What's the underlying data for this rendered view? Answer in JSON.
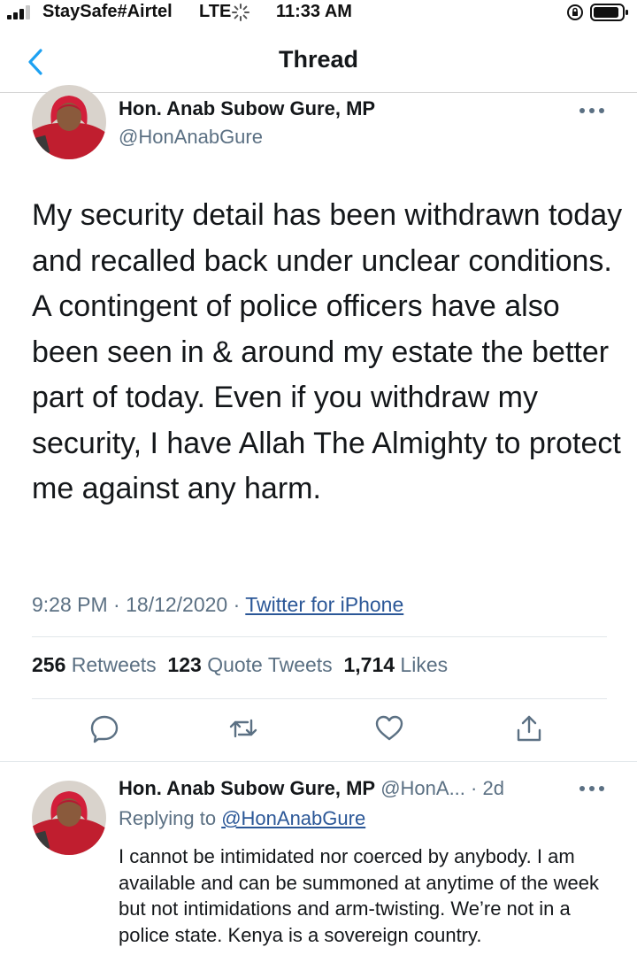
{
  "status_bar": {
    "carrier": "StaySafe#Airtel",
    "network": "LTE",
    "time": "11:33 AM"
  },
  "nav": {
    "title": "Thread",
    "back_icon": "chevron-left-icon"
  },
  "tweet": {
    "author_name": "Hon. Anab Subow Gure, MP",
    "author_handle": "@HonAnabGure",
    "text": "My security detail has been withdrawn today and recalled back under unclear conditions. A contingent of police officers have also been seen in & around my estate the better part of today. Even if you withdraw my security, I have Allah The Almighty to protect me against any harm.",
    "time": "9:28 PM",
    "date": "18/12/2020",
    "separator": "·",
    "source": "Twitter for iPhone",
    "retweets_count": "256",
    "retweets_label": "Retweets",
    "quotes_count": "123",
    "quotes_label": "Quote Tweets",
    "likes_count": "1,714",
    "likes_label": "Likes"
  },
  "reply": {
    "author_name": "Hon. Anab Subow Gure, MP",
    "author_handle": "@HonA...",
    "age": "· 2d",
    "replying_label": "Replying to",
    "replying_handle": "@HonAnabGure",
    "text": "I cannot be intimidated nor coerced by anybody. I am available and can be summoned at anytime of the week but not intimidations and arm-twisting. We’re not in a police state. Kenya is a sovereign country."
  },
  "colors": {
    "text": "#14171a",
    "secondary": "#5b7083",
    "link": "#2b5797",
    "accent": "#1da1f2"
  }
}
